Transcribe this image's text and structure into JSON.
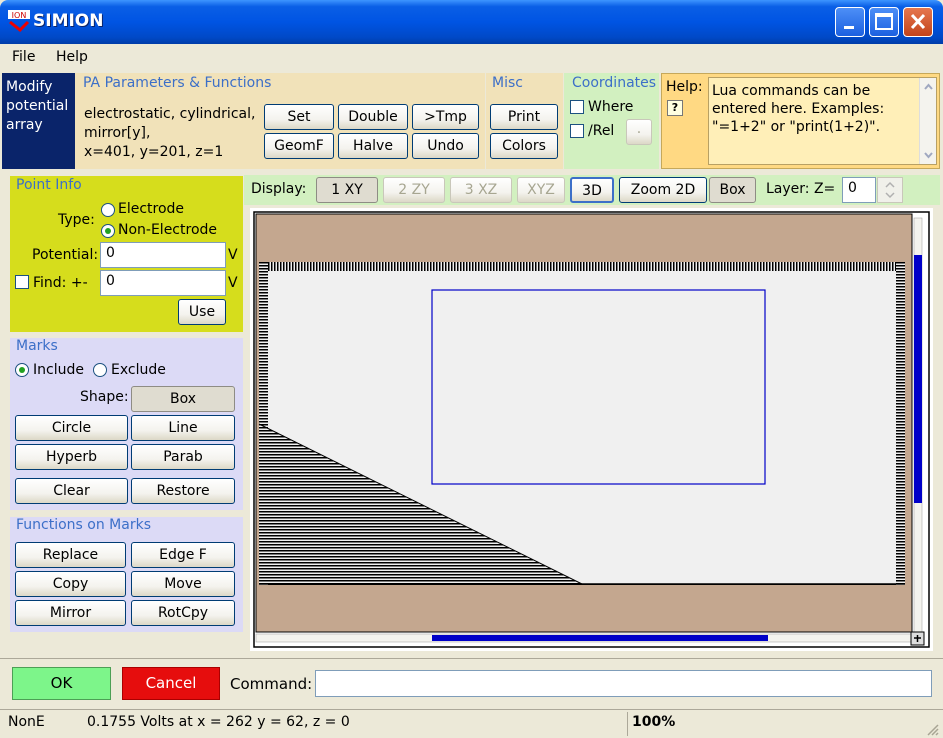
{
  "window": {
    "title": "SIMION",
    "icon_text": "ION"
  },
  "menu": [
    "File",
    "Help"
  ],
  "modify": {
    "label": "Modify potential array"
  },
  "pa": {
    "title": "PA Parameters & Functions",
    "desc1": "electrostatic, cylindrical,",
    "desc2": "mirror[y],",
    "desc3": "x=401, y=201, z=1",
    "buttons": [
      "Set",
      "Double",
      ">Tmp",
      "GeomF",
      "Halve",
      "Undo"
    ]
  },
  "misc": {
    "title": "Misc",
    "buttons": [
      "Print",
      "Colors"
    ]
  },
  "coords": {
    "title": "Coordinates",
    "where": "Where",
    "rel": "/Rel",
    "small_btn": "."
  },
  "help": {
    "label": "Help:",
    "icon": "?",
    "text": "Lua commands can be entered here.  Examples: \"=1+2\" or \"print(1+2)\"."
  },
  "point_info": {
    "title": "Point Info",
    "type_label": "Type:",
    "electrode": "Electrode",
    "non_electrode": "Non-Electrode",
    "potential_label": "Potential:",
    "potential_value": "0",
    "unit": "V",
    "find_label": "Find:  +-",
    "find_value": "0",
    "use": "Use"
  },
  "marks": {
    "title": "Marks",
    "include": "Include",
    "exclude": "Exclude",
    "shape_label": "Shape:",
    "shape_value": "Box",
    "buttons": [
      "Circle",
      "Line",
      "Hyperb",
      "Parab",
      "Clear",
      "Restore"
    ]
  },
  "functions": {
    "title": "Functions on Marks",
    "buttons": [
      "Replace",
      "Edge F",
      "Copy",
      "Move",
      "Mirror",
      "RotCpy"
    ]
  },
  "display": {
    "label": "Display:",
    "views": [
      "1 XY",
      "2 ZY",
      "3 XZ",
      "XYZ"
    ],
    "btn_3d": "3D",
    "zoom": "Zoom 2D",
    "box": "Box",
    "layer_label": "Layer: Z=",
    "layer_value": "0"
  },
  "bottom": {
    "ok": "OK",
    "cancel": "Cancel",
    "command_label": "Command:",
    "command_value": ""
  },
  "status": {
    "mode": "NonE",
    "reading": "0.1755 Volts at x = 262 y = 62, z = 0",
    "zoom": "100%"
  },
  "colors": {
    "ok": "#7DF58A",
    "cancel": "#E60D0D",
    "electrode_tan": "#C4A78F",
    "mark_blue": "#0000C8"
  }
}
